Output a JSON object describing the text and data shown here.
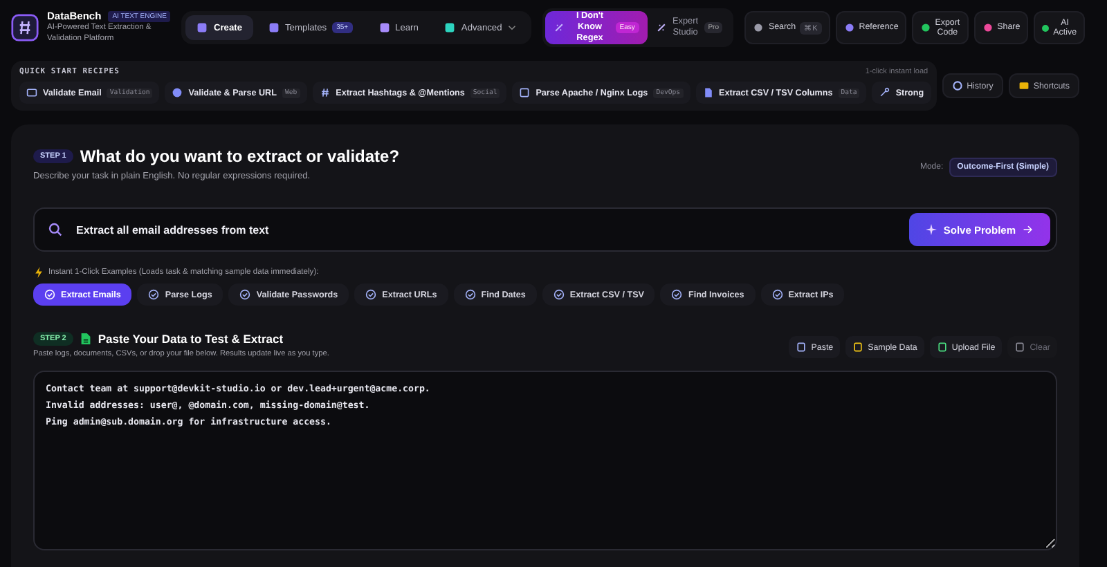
{
  "header": {
    "brand": "DataBench",
    "badge": "AI TEXT ENGINE",
    "tagline": "AI-Powered Text Extraction & Validation Platform",
    "nav": [
      {
        "kind": "create",
        "label": "Create",
        "selected": true
      },
      {
        "kind": "templates",
        "label": "Templates",
        "count": "35+",
        "selected": false
      },
      {
        "kind": "learn",
        "label": "Learn",
        "selected": false
      },
      {
        "kind": "advanced",
        "label": "Advanced",
        "selected": false
      }
    ],
    "modes": [
      {
        "label": "I Don't Know Regex",
        "tag": "Easy",
        "selected": true
      },
      {
        "label": "Expert Studio",
        "tag": "Pro",
        "selected": false
      }
    ],
    "tools": [
      {
        "kind": "search",
        "label": "Search",
        "shortcut": "⌘K"
      },
      {
        "kind": "reference",
        "label": "Reference"
      },
      {
        "kind": "export",
        "label": "Export Code"
      },
      {
        "kind": "share",
        "label": "Share"
      }
    ],
    "status": "AI Active"
  },
  "recipes": {
    "title": "QUICK START RECIPES",
    "hint": "1-click instant load",
    "items": [
      {
        "kind": "email",
        "label": "Validate Email",
        "tag": "Validation"
      },
      {
        "kind": "globe",
        "label": "Validate & Parse URL",
        "tag": "Web"
      },
      {
        "kind": "hash",
        "label": "Extract Hashtags & @Mentions",
        "tag": "Social"
      },
      {
        "kind": "server",
        "label": "Parse Apache / Nginx Logs",
        "tag": "DevOps"
      },
      {
        "kind": "file",
        "label": "Extract CSV / TSV Columns",
        "tag": "Data"
      },
      {
        "kind": "key",
        "label": "Strong"
      }
    ]
  },
  "side_buttons": [
    {
      "kind": "history",
      "label": "History"
    },
    {
      "kind": "shortcuts",
      "label": "Shortcuts"
    }
  ],
  "step1": {
    "step": "STEP 1",
    "title": "What do you want to extract or validate?",
    "subtitle": "Describe your task in plain English. No regular expressions required.",
    "mode_label": "Mode:",
    "mode": "Outcome-First (Simple)",
    "query": "Extract all email addresses from text",
    "solve": "Solve Problem",
    "examples_label": "Instant 1-Click Examples (Loads task & matching sample data immediately):",
    "examples": [
      {
        "label": "Extract Emails",
        "selected": true
      },
      {
        "label": "Parse Logs",
        "selected": false
      },
      {
        "label": "Validate Passwords",
        "selected": false
      },
      {
        "label": "Extract URLs",
        "selected": false
      },
      {
        "label": "Find Dates",
        "selected": false
      },
      {
        "label": "Extract CSV / TSV",
        "selected": false
      },
      {
        "label": "Find Invoices",
        "selected": false
      },
      {
        "label": "Extract IPs",
        "selected": false
      }
    ]
  },
  "step2": {
    "step": "STEP 2",
    "title": "Paste Your Data to Test & Extract",
    "subtitle": "Paste logs, documents, CSVs, or drop your file below. Results update live as you type.",
    "actions": [
      {
        "kind": "paste",
        "label": "Paste",
        "disabled": false
      },
      {
        "kind": "sample",
        "label": "Sample Data",
        "disabled": false
      },
      {
        "kind": "upload",
        "label": "Upload File",
        "disabled": false
      },
      {
        "kind": "clear",
        "label": "Clear",
        "disabled": true
      }
    ],
    "data": "Contact team at support@devkit-studio.io or dev.lead+urgent@acme.corp.\nInvalid addresses: user@, @domain.com, missing-domain@test.\nPing admin@sub.domain.org for infrastructure access."
  }
}
